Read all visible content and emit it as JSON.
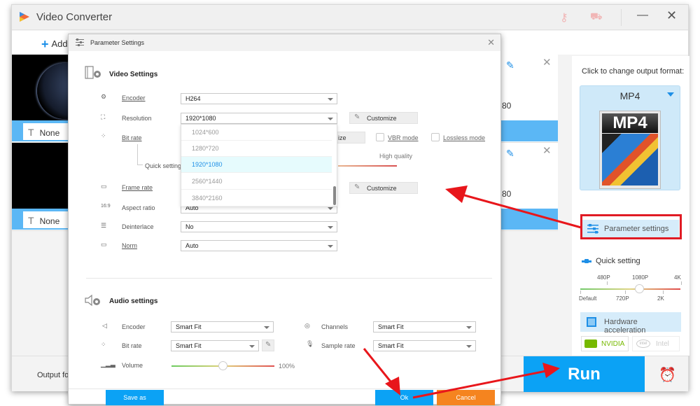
{
  "app": {
    "title": "Video Converter",
    "add_label": "Add",
    "min_glyph": "—",
    "close_glyph": "✕",
    "key_glyph": "⚷",
    "cart_glyph": "🛒"
  },
  "files": [
    {
      "subtitle": "None",
      "resolution_partial": "80"
    },
    {
      "subtitle": "None",
      "resolution_partial": "80"
    }
  ],
  "right_panel": {
    "output_format_prompt": "Click to change output format:",
    "format": "MP4",
    "format_image_label": "MP4",
    "parameter_settings_label": "Parameter settings",
    "quick_setting_label": "Quick setting",
    "quick_setting_top_ticks": [
      "480P",
      "1080P",
      "4K"
    ],
    "quick_setting_bottom_ticks": [
      "Default",
      "720P",
      "2K"
    ],
    "quick_setting_value": "1080P",
    "hardware_acceleration_label": "Hardware acceleration",
    "nvidia_label": "NVIDIA",
    "intel_label": "Intel"
  },
  "bottom": {
    "output_folder_label": "Output fol",
    "run_label": "Run"
  },
  "dialog": {
    "title": "Parameter Settings",
    "close_glyph": "✕",
    "video": {
      "section_title": "Video Settings",
      "encoder_label": "Encoder",
      "encoder_value": "H264",
      "resolution_label": "Resolution",
      "resolution_value": "1920*1080",
      "customize_label": "Customize",
      "bitrate_label": "Bit rate",
      "bitrate_customize_partial": "ize",
      "vbr_label": "VBR mode",
      "lossless_label": "Lossless mode",
      "quick_setting_label": "Quick setting",
      "high_quality_label": "High quality",
      "framerate_label": "Frame rate",
      "framerate_customize_label": "Customize",
      "aspect_label": "Aspect ratio",
      "aspect_value": "Auto",
      "deinterlace_label": "Deinterlace",
      "deinterlace_value": "No",
      "norm_label": "Norm",
      "norm_value": "Auto",
      "resolution_options": [
        "1024*600",
        "1280*720",
        "1920*1080",
        "2560*1440",
        "3840*2160"
      ],
      "resolution_selected_index": 2
    },
    "audio": {
      "section_title": "Audio settings",
      "encoder_label": "Encoder",
      "encoder_value": "Smart Fit",
      "bitrate_label": "Bit rate",
      "bitrate_value": "Smart Fit",
      "volume_label": "Volume",
      "volume_value": "100%",
      "channels_label": "Channels",
      "channels_value": "Smart Fit",
      "samplerate_label": "Sample rate",
      "samplerate_value": "Smart Fit"
    },
    "save_as_label": "Save as",
    "ok_label": "Ok",
    "cancel_label": "Cancel"
  },
  "colors": {
    "accent_blue": "#0ba2f5",
    "cancel_orange": "#f5841f",
    "highlight_red": "#e01b24"
  }
}
